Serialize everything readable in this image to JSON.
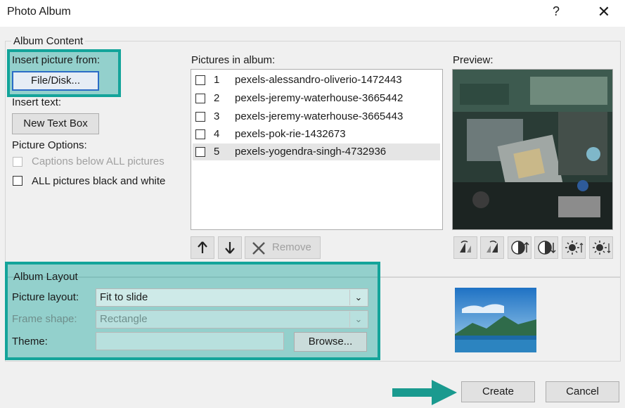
{
  "window": {
    "title": "Photo Album",
    "help": "?",
    "close": "✕"
  },
  "album_content": {
    "legend": "Album Content",
    "insert_picture_from": "Insert picture from:",
    "file_disk_button": "File/Disk...",
    "insert_text": "Insert text:",
    "new_text_box_button": "New Text Box",
    "picture_options": "Picture Options:",
    "captions_label": "Captions below ALL pictures",
    "black_white_label": "ALL pictures black and white"
  },
  "pictures_in_album": {
    "label": "Pictures in album:",
    "items": [
      {
        "num": "1",
        "name": "pexels-alessandro-oliverio-1472443"
      },
      {
        "num": "2",
        "name": "pexels-jeremy-waterhouse-3665442"
      },
      {
        "num": "3",
        "name": "pexels-jeremy-waterhouse-3665443"
      },
      {
        "num": "4",
        "name": "pexels-pok-rie-1432673"
      },
      {
        "num": "5",
        "name": "pexels-yogendra-singh-4732936"
      }
    ],
    "selected_index": 4,
    "remove_button": "Remove"
  },
  "preview": {
    "label": "Preview:"
  },
  "album_layout": {
    "legend": "Album Layout",
    "picture_layout_label": "Picture layout:",
    "picture_layout_value": "Fit to slide",
    "frame_shape_label": "Frame shape:",
    "frame_shape_value": "Rectangle",
    "theme_label": "Theme:",
    "theme_value": "",
    "browse_button": "Browse..."
  },
  "footer": {
    "create_button": "Create",
    "cancel_button": "Cancel"
  },
  "colors": {
    "highlight": "#14a49a",
    "arrow": "#1a9a8f"
  }
}
